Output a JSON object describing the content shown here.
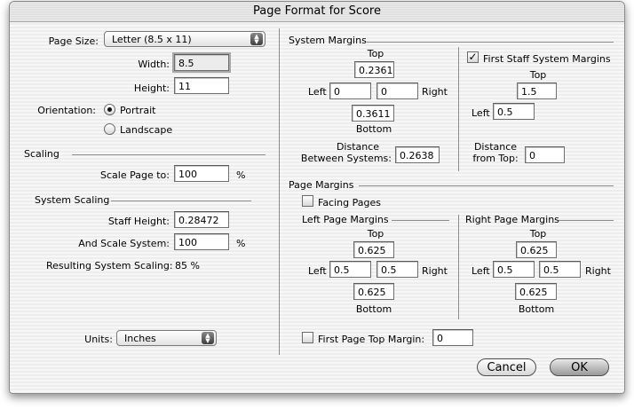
{
  "window": {
    "title": "Page Format for Score"
  },
  "page": {
    "size_label": "Page Size:",
    "size_value": "Letter (8.5 x 11)",
    "width_label": "Width:",
    "width_value": "8.5",
    "height_label": "Height:",
    "height_value": "11",
    "orientation_label": "Orientation:",
    "portrait_label": "Portrait",
    "landscape_label": "Landscape",
    "orientation_selected": "Portrait"
  },
  "scaling": {
    "header": "Scaling",
    "scale_label": "Scale Page to:",
    "scale_value": "100",
    "percent": "%"
  },
  "system_scaling": {
    "header": "System Scaling",
    "staff_height_label": "Staff Height:",
    "staff_height_value": "0.28472",
    "and_scale_label": "And Scale System:",
    "and_scale_value": "100",
    "percent": "%",
    "resulting_label": "Resulting System Scaling:",
    "resulting_value": "85 %"
  },
  "units": {
    "label": "Units:",
    "value": "Inches"
  },
  "system_margins": {
    "header": "System Margins",
    "top_label": "Top",
    "top_value": "0.2361",
    "left_label": "Left",
    "left_value": "0",
    "right_value": "0",
    "right_label": "Right",
    "bottom_value": "0.3611",
    "bottom_label": "Bottom",
    "distance_label_1": "Distance",
    "distance_label_2": "Between Systems:",
    "distance_value": "0.2638"
  },
  "first_staff": {
    "checkbox_label": "First Staff System Margins",
    "checked": true,
    "top_label": "Top",
    "top_value": "1.5",
    "left_label": "Left",
    "left_value": "0.5",
    "distance_label_1": "Distance",
    "distance_label_2": "from Top:",
    "distance_value": "0"
  },
  "page_margins": {
    "header": "Page Margins",
    "facing_label": "Facing Pages",
    "facing_checked": false,
    "left_header": "Left Page Margins",
    "right_header": "Right Page Margins",
    "left_page": {
      "top_label": "Top",
      "top": "0.625",
      "left_label": "Left",
      "left": "0.5",
      "right": "0.5",
      "right_label": "Right",
      "bottom": "0.625",
      "bottom_label": "Bottom"
    },
    "right_page": {
      "top_label": "Top",
      "top": "0.625",
      "left_label": "Left",
      "left": "0.5",
      "right": "0.5",
      "right_label": "Right",
      "bottom": "0.625",
      "bottom_label": "Bottom"
    },
    "first_page_label": "First Page Top Margin:",
    "first_page_checked": false,
    "first_page_value": "0"
  },
  "buttons": {
    "cancel": "Cancel",
    "ok": "OK"
  }
}
